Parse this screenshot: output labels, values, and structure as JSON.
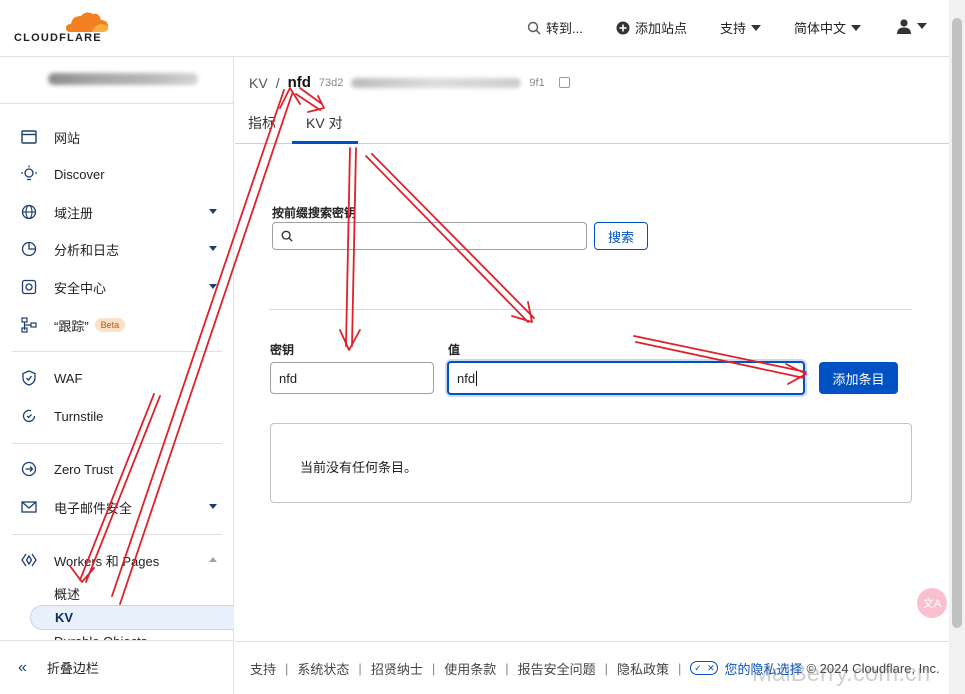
{
  "topbar": {
    "logo_text": "CLOUDFLARE",
    "goto_label": "转到...",
    "add_site_label": "添加站点",
    "support_label": "支持",
    "language_label": "简体中文"
  },
  "sidebar": {
    "items": [
      {
        "label": "网站",
        "icon": "browser-window-icon"
      },
      {
        "label": "Discover",
        "icon": "lightbulb-icon"
      },
      {
        "label": "域注册",
        "icon": "globe-icon"
      },
      {
        "label": "分析和日志",
        "icon": "pie-chart-icon"
      },
      {
        "label": "安全中心",
        "icon": "shield-center-icon"
      },
      {
        "label": "“跟踪”",
        "icon": "trace-icon",
        "badge": "Beta"
      },
      {
        "label": "WAF",
        "icon": "waf-shield-icon"
      },
      {
        "label": "Turnstile",
        "icon": "turnstile-icon"
      },
      {
        "label": "Zero Trust",
        "icon": "zero-trust-icon"
      },
      {
        "label": "电子邮件安全",
        "icon": "envelope-icon"
      },
      {
        "label": "Workers 和 Pages",
        "icon": "workers-icon"
      }
    ],
    "sub_items": [
      "概述",
      "KV",
      "Durable Objects"
    ],
    "collapse_label": "折叠边栏"
  },
  "main": {
    "breadcrumb_root": "KV",
    "breadcrumb_current": "nfd",
    "namespace_id_prefix": "73d2",
    "namespace_id_suffix": "9f1",
    "tabs": [
      "指标",
      "KV 对"
    ],
    "search_label": "按前缀搜索密钥",
    "search_placeholder": "",
    "search_button": "搜索",
    "key_label": "密钥",
    "key_value": "nfd",
    "value_label": "值",
    "value_value": "nfd",
    "add_button": "添加条目",
    "empty_text": "当前没有任何条目。"
  },
  "footer": {
    "links": [
      "支持",
      "系统状态",
      "招贤纳士",
      "使用条款",
      "报告安全问题",
      "隐私政策"
    ],
    "privacy_choice": "您的隐私选择",
    "copyright": "© 2024 Cloudflare, Inc."
  },
  "watermark": "MalBerry.com.cn",
  "colors": {
    "accent": "#0051c3",
    "logo_orange": "#f38020",
    "annotation_red": "#e0202a"
  }
}
